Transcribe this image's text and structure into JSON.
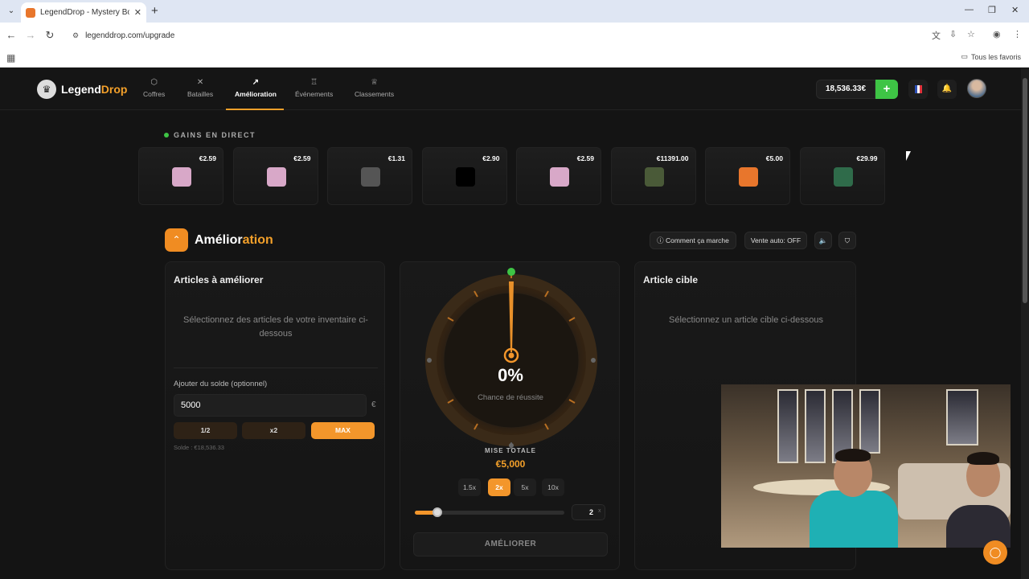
{
  "browser": {
    "tab_title": "LegendDrop - Mystery Boxes &",
    "url": "legenddrop.com/upgrade",
    "bookmarks_label": "Tous les favoris"
  },
  "nav": {
    "logo_part1": "Legend",
    "logo_part2": "Drop",
    "items": [
      {
        "label": "Coffres",
        "icon": "box-icon"
      },
      {
        "label": "Batailles",
        "icon": "swords-icon"
      },
      {
        "label": "Amélioration",
        "icon": "trend-up-icon"
      },
      {
        "label": "Événements",
        "icon": "trophy-icon"
      },
      {
        "label": "Classements",
        "icon": "crown-icon"
      }
    ],
    "balance": "18,536.33€",
    "add_label": "+"
  },
  "live": {
    "label": "GAINS EN DIRECT",
    "drops": [
      {
        "price": "€2.59",
        "color": "#d8a8c8"
      },
      {
        "price": "€2.59",
        "color": "#d8a8c8"
      },
      {
        "price": "€1.31",
        "color": "#555555"
      },
      {
        "price": "€2.90",
        "color": "#000000"
      },
      {
        "price": "€2.59",
        "color": "#d8a8c8"
      },
      {
        "price": "€11391.00",
        "color": "#4a5a38"
      },
      {
        "price": "€5.00",
        "color": "#e8762c"
      },
      {
        "price": "€29.99",
        "color": "#2f6b4a"
      }
    ]
  },
  "section": {
    "title_part1": "Amélior",
    "title_part2": "ation",
    "how_label": "Comment ça marche",
    "auto_sell_label": "Vente auto: OFF"
  },
  "left_panel": {
    "title": "Articles à améliorer",
    "hint": "Sélectionnez des articles de votre inventaire ci-dessous",
    "balance_label": "Ajouter du solde (optionnel)",
    "amount_value": "5000",
    "unit": "€",
    "btn_half": "1/2",
    "btn_double": "x2",
    "btn_max": "MAX",
    "solde": "Solde : €18,536.33"
  },
  "center_panel": {
    "percent": "0%",
    "chance_label": "Chance de réussite",
    "mise_label": "MISE TOTALE",
    "mise_value": "€5,000",
    "multipliers": [
      "1.5x",
      "2x",
      "5x",
      "10x"
    ],
    "active_multiplier": "2x",
    "multiplier_value": "2",
    "multiplier_suffix": "x",
    "slider_level": 0.12,
    "upgrade_label": "AMÉLIORER"
  },
  "right_panel": {
    "title": "Article cible",
    "hint": "Sélectionnez un article cible ci-dessous"
  },
  "colors": {
    "accent": "#f3a02a",
    "success": "#3ec445"
  }
}
